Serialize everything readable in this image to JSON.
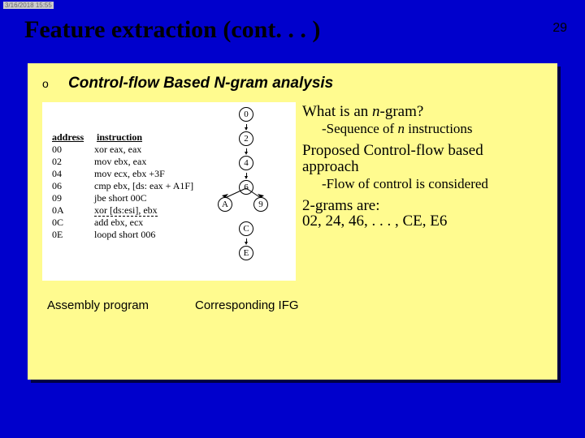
{
  "meta": {
    "datetime": "3/16/2018  15:55"
  },
  "title": "Feature extraction (cont. . . )",
  "page_number": "29",
  "bullet": {
    "mark": "o",
    "text": "Control-flow Based N-gram analysis"
  },
  "figure": {
    "headers": {
      "addr": "address",
      "ins": "instruction"
    },
    "rows": [
      {
        "addr": "00",
        "ins": "xor eax, eax"
      },
      {
        "addr": "02",
        "ins": "mov ebx, eax"
      },
      {
        "addr": "04",
        "ins": "mov ecx, ebx +3F"
      },
      {
        "addr": "06",
        "ins": "cmp ebx, [ds: eax + A1F]"
      },
      {
        "addr": "09",
        "ins": "jbe short 00C"
      },
      {
        "addr": "0A",
        "ins": "xor [ds:esi], ebx"
      },
      {
        "addr": "0C",
        "ins": "add ebx, ecx"
      },
      {
        "addr": "0E",
        "ins": "loopd short 006"
      }
    ],
    "nodes_top": [
      "0",
      "2",
      "4",
      "6"
    ],
    "branch": {
      "left": "A",
      "right": "9"
    },
    "nodes_bottom": [
      "C",
      "E"
    ]
  },
  "captions": {
    "asm": "Assembly program",
    "ifg": "Corresponding IFG"
  },
  "right": {
    "q1": "What is an ",
    "q1_ital": "n",
    "q1_tail": "-gram?",
    "sub1a": "-Sequence of ",
    "sub1_ital": "n",
    "sub1b": " instructions",
    "q2a": "Proposed Control-flow based",
    "q2b": "approach",
    "sub2": "-Flow of control is considered",
    "q3a": "2-grams are:",
    "q3b": "02, 24, 46, . . . , CE, E6"
  }
}
